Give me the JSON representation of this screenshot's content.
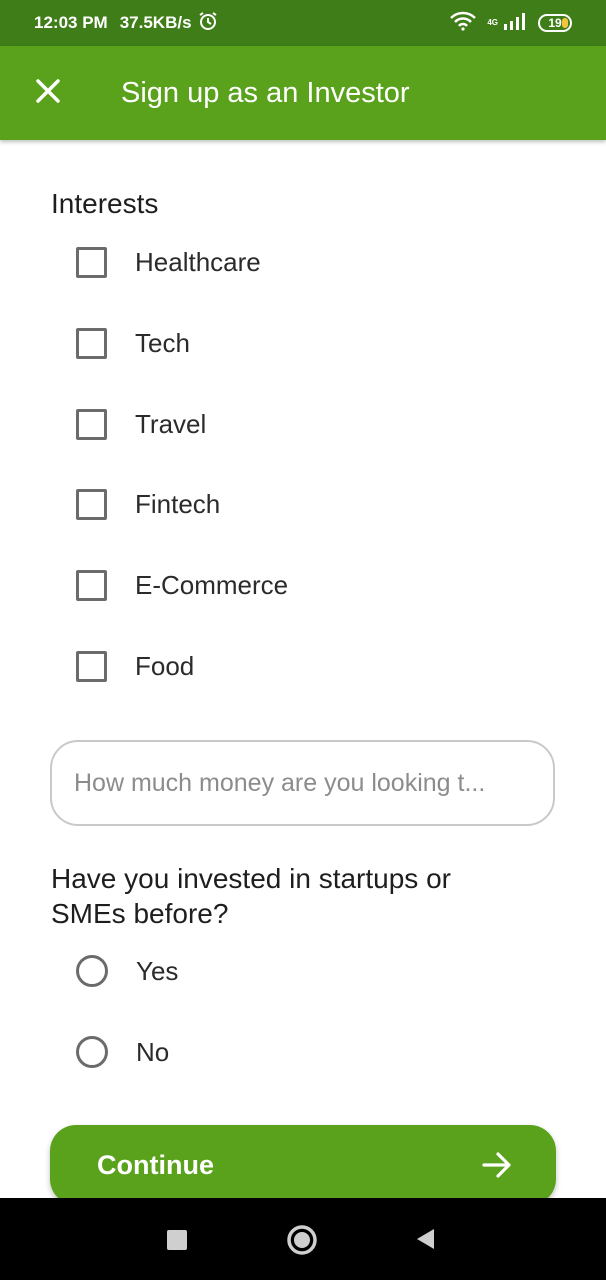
{
  "status_bar": {
    "time": "12:03 PM",
    "speed": "37.5KB/s",
    "network": "4G",
    "battery": "19"
  },
  "app_bar": {
    "title": "Sign up as an Investor",
    "close_icon": "close-icon",
    "color": "#5aa21c"
  },
  "interests": {
    "title": "Interests",
    "options": [
      "Healthcare",
      "Tech",
      "Travel",
      "Fintech",
      "E-Commerce",
      "Food"
    ]
  },
  "amount": {
    "placeholder": "How much money are you looking t...",
    "value": ""
  },
  "invested_before": {
    "title_line1": "Have you invested in startups or",
    "title_line2": "SMEs before?",
    "options": [
      "Yes",
      "No"
    ]
  },
  "continue": {
    "label": "Continue",
    "icon": "arrow-right-icon"
  },
  "nav": {
    "recents_icon": "square-icon",
    "home_icon": "circle-icon",
    "back_icon": "triangle-back-icon"
  }
}
